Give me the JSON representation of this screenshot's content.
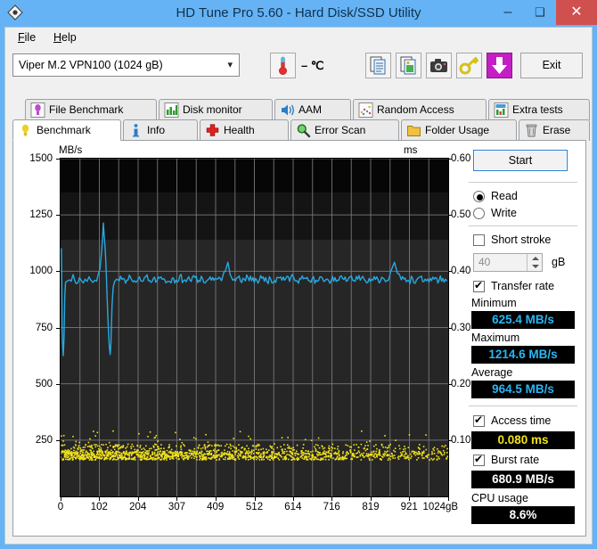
{
  "window": {
    "title": "HD Tune Pro 5.60 - Hard Disk/SSD Utility",
    "app_icon": "diamond-icon",
    "minimize": "–",
    "maximize": "❑",
    "close": "✕"
  },
  "menu": {
    "items": [
      {
        "label": "File",
        "accel": "F"
      },
      {
        "label": "Help",
        "accel": "H"
      }
    ]
  },
  "toolbar": {
    "drive": "Viper M.2 VPN100 (1024 gB)",
    "drive_caret": "⌄",
    "temperature": "– ℃",
    "buttons": [
      {
        "name": "copy-button",
        "icon": "copy-icon"
      },
      {
        "name": "copy-image-button",
        "icon": "copy-image-icon"
      },
      {
        "name": "screenshot-button",
        "icon": "camera-icon"
      },
      {
        "name": "key-button",
        "icon": "key-icon"
      },
      {
        "name": "save-button",
        "icon": "download-arrow-icon"
      }
    ],
    "exit_label": "Exit"
  },
  "tabs": {
    "row1": [
      {
        "label": "File Benchmark",
        "icon": "bulb-purple-icon",
        "left": 22,
        "width": 148,
        "active": false
      },
      {
        "label": "Disk monitor",
        "icon": "bar-chart-icon",
        "left": 172,
        "width": 128,
        "active": false
      },
      {
        "label": "AAM",
        "icon": "speaker-icon",
        "left": 302,
        "width": 86,
        "active": false
      },
      {
        "label": "Random Access",
        "icon": "scatter-icon",
        "left": 390,
        "width": 150,
        "active": false
      },
      {
        "label": "Extra tests",
        "icon": "chart-icon",
        "left": 542,
        "width": 114,
        "active": false
      }
    ],
    "row2": [
      {
        "label": "Benchmark",
        "icon": "bulb-yellow-icon",
        "left": 8,
        "width": 122,
        "active": true
      },
      {
        "label": "Info",
        "icon": "info-icon",
        "left": 132,
        "width": 84,
        "active": false
      },
      {
        "label": "Health",
        "icon": "cross-icon",
        "left": 218,
        "width": 100,
        "active": false
      },
      {
        "label": "Error Scan",
        "icon": "magnifier-icon",
        "left": 320,
        "width": 122,
        "active": false
      },
      {
        "label": "Folder Usage",
        "icon": "folder-icon",
        "left": 444,
        "width": 130,
        "active": false
      },
      {
        "label": "Erase",
        "icon": "trash-icon",
        "left": 576,
        "width": 80,
        "active": false
      }
    ]
  },
  "panel": {
    "start_label": "Start",
    "mode": [
      {
        "label": "Read",
        "selected": true
      },
      {
        "label": "Write",
        "selected": false
      }
    ],
    "short_stroke": {
      "label": "Short stroke",
      "checked": false,
      "value": "40",
      "unit": "gB"
    },
    "transfer_rate": {
      "label": "Transfer rate",
      "checked": true
    },
    "results": [
      {
        "label": "Minimum",
        "value": "625.4 MB/s",
        "color": "cyan"
      },
      {
        "label": "Maximum",
        "value": "1214.6 MB/s",
        "color": "cyan"
      },
      {
        "label": "Average",
        "value": "964.5 MB/s",
        "color": "cyan"
      }
    ],
    "access_time": {
      "label": "Access time",
      "checked": true,
      "value": "0.080 ms",
      "color": "yellow"
    },
    "burst_rate": {
      "label": "Burst rate",
      "checked": true,
      "value": "680.9 MB/s",
      "color": "white"
    },
    "cpu_usage": {
      "label": "CPU usage",
      "value": "8.6%",
      "color": "white"
    }
  },
  "chart_data": {
    "type": "line",
    "title": "",
    "ylabel": "MB/s",
    "y2label": "ms",
    "xlabel": "gB",
    "xlim": [
      0,
      1024
    ],
    "ylim": [
      0,
      1500
    ],
    "y2lim": [
      0,
      0.6
    ],
    "grid": true,
    "xticks": [
      0,
      102,
      204,
      307,
      409,
      512,
      614,
      716,
      819,
      921,
      1024
    ],
    "xtick_labels": [
      "0",
      "102",
      "204",
      "307",
      "409",
      "512",
      "614",
      "716",
      "819",
      "921",
      "1024gB"
    ],
    "yticks": [
      250,
      500,
      750,
      1000,
      1250,
      1500
    ],
    "ytick_labels": [
      "250",
      "500",
      "750",
      "1000",
      "1250",
      "1500"
    ],
    "y2ticks": [
      0.1,
      0.2,
      0.3,
      0.4,
      0.5,
      0.6
    ],
    "y2tick_labels": [
      "0.10",
      "0.20",
      "0.30",
      "0.40",
      "0.50",
      "0.60"
    ],
    "plot_bg": "#0b0b0b",
    "grid_color": "#7d7d7d",
    "series": [
      {
        "name": "Transfer rate",
        "color": "#29a8e0",
        "axis": "left",
        "units": "MB/s",
        "points": [
          [
            2,
            1100
          ],
          [
            3,
            980
          ],
          [
            4,
            760
          ],
          [
            5,
            700
          ],
          [
            6,
            660
          ],
          [
            7,
            625
          ],
          [
            9,
            700
          ],
          [
            11,
            880
          ],
          [
            13,
            950
          ],
          [
            16,
            955
          ],
          [
            20,
            958
          ],
          [
            24,
            962
          ],
          [
            28,
            955
          ],
          [
            33,
            985
          ],
          [
            37,
            960
          ],
          [
            41,
            945
          ],
          [
            46,
            950
          ],
          [
            50,
            972
          ],
          [
            55,
            958
          ],
          [
            60,
            948
          ],
          [
            65,
            965
          ],
          [
            70,
            955
          ],
          [
            75,
            975
          ],
          [
            80,
            960
          ],
          [
            85,
            950
          ],
          [
            90,
            960
          ],
          [
            95,
            955
          ],
          [
            100,
            990
          ],
          [
            104,
            1010
          ],
          [
            108,
            1080
          ],
          [
            111,
            1150
          ],
          [
            113,
            1214
          ],
          [
            115,
            1160
          ],
          [
            117,
            1120
          ],
          [
            119,
            1060
          ],
          [
            121,
            980
          ],
          [
            123,
            880
          ],
          [
            125,
            790
          ],
          [
            127,
            720
          ],
          [
            129,
            660
          ],
          [
            131,
            630
          ],
          [
            133,
            680
          ],
          [
            136,
            850
          ],
          [
            139,
            930
          ],
          [
            143,
            955
          ],
          [
            148,
            965
          ],
          [
            155,
            958
          ],
          [
            165,
            968
          ],
          [
            175,
            960
          ],
          [
            185,
            972
          ],
          [
            195,
            958
          ],
          [
            205,
            965
          ],
          [
            215,
            955
          ],
          [
            225,
            975
          ],
          [
            235,
            960
          ],
          [
            245,
            968
          ],
          [
            255,
            958
          ],
          [
            265,
            975
          ],
          [
            275,
            962
          ],
          [
            285,
            955
          ],
          [
            295,
            970
          ],
          [
            305,
            960
          ],
          [
            315,
            980
          ],
          [
            325,
            958
          ],
          [
            335,
            965
          ],
          [
            345,
            955
          ],
          [
            355,
            972
          ],
          [
            365,
            960
          ],
          [
            375,
            968
          ],
          [
            385,
            955
          ],
          [
            395,
            975
          ],
          [
            405,
            960
          ],
          [
            415,
            965
          ],
          [
            425,
            958
          ],
          [
            435,
            1000
          ],
          [
            442,
            1040
          ],
          [
            448,
            985
          ],
          [
            455,
            960
          ],
          [
            465,
            970
          ],
          [
            475,
            958
          ],
          [
            485,
            965
          ],
          [
            495,
            972
          ],
          [
            505,
            958
          ],
          [
            515,
            968
          ],
          [
            525,
            960
          ],
          [
            535,
            975
          ],
          [
            545,
            955
          ],
          [
            555,
            965
          ],
          [
            565,
            958
          ],
          [
            575,
            972
          ],
          [
            585,
            960
          ],
          [
            595,
            968
          ],
          [
            605,
            955
          ],
          [
            615,
            975
          ],
          [
            625,
            958
          ],
          [
            635,
            965
          ],
          [
            645,
            970
          ],
          [
            655,
            958
          ],
          [
            665,
            968
          ],
          [
            675,
            960
          ],
          [
            685,
            975
          ],
          [
            695,
            955
          ],
          [
            705,
            965
          ],
          [
            715,
            958
          ],
          [
            725,
            972
          ],
          [
            735,
            960
          ],
          [
            745,
            968
          ],
          [
            755,
            955
          ],
          [
            765,
            975
          ],
          [
            775,
            958
          ],
          [
            785,
            965
          ],
          [
            795,
            970
          ],
          [
            805,
            958
          ],
          [
            815,
            968
          ],
          [
            825,
            960
          ],
          [
            835,
            975
          ],
          [
            845,
            955
          ],
          [
            855,
            965
          ],
          [
            865,
            958
          ],
          [
            875,
            1010
          ],
          [
            882,
            1040
          ],
          [
            890,
            990
          ],
          [
            900,
            962
          ],
          [
            910,
            970
          ],
          [
            920,
            958
          ],
          [
            930,
            968
          ],
          [
            940,
            960
          ],
          [
            950,
            975
          ],
          [
            960,
            955
          ],
          [
            970,
            965
          ],
          [
            980,
            958
          ],
          [
            990,
            972
          ],
          [
            1000,
            960
          ],
          [
            1010,
            968
          ],
          [
            1020,
            958
          ]
        ]
      }
    ],
    "scatter": [
      {
        "name": "Access time",
        "color": "#f2e31b",
        "axis": "right",
        "units": "ms",
        "note": "dense band around 0.070-0.080 ms with sparse outliers up to ~0.115 ms, thinning toward the right half",
        "dense_band": [
          0.066,
          0.082
        ],
        "outlier_max": 0.118,
        "average": 0.08
      }
    ]
  }
}
